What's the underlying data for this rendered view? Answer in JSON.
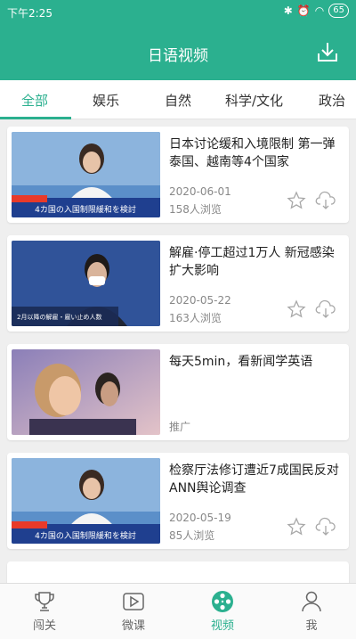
{
  "status_bar": {
    "time": "下午2:25",
    "battery": "65"
  },
  "header": {
    "title": "日语视频"
  },
  "tabs": [
    {
      "label": "全部",
      "active": true
    },
    {
      "label": "娱乐",
      "active": false
    },
    {
      "label": "自然",
      "active": false
    },
    {
      "label": "科学/文化",
      "active": false
    },
    {
      "label": "政治",
      "active": false
    }
  ],
  "videos": [
    {
      "title": "日本讨论缓和入境限制 第一弹泰国、越南等4个国家",
      "date": "2020-06-01",
      "views": "158人浏览",
      "thumb_caption": "4カ国の入国制限緩和を検討"
    },
    {
      "title": "解雇·停工超过1万人 新冠感染扩大影响",
      "date": "2020-05-22",
      "views": "163人浏览",
      "thumb_caption": "2月以降の解雇・雇い止め人数"
    },
    {
      "title": "每天5min，看新闻学英语",
      "ad_label": "推广"
    },
    {
      "title": "检察厅法修订遭近7成国民反对 ANN舆论调查",
      "date": "2020-05-19",
      "views": "85人浏览",
      "thumb_caption": "4カ国の入国制限緩和を検討"
    }
  ],
  "bottom_nav": [
    {
      "label": "闯关",
      "icon": "trophy-icon",
      "active": false
    },
    {
      "label": "微课",
      "icon": "play-icon",
      "active": false
    },
    {
      "label": "视频",
      "icon": "film-reel-icon",
      "active": true
    },
    {
      "label": "我",
      "icon": "person-icon",
      "active": false
    }
  ],
  "colors": {
    "accent": "#2bb08f",
    "background": "#efefef"
  }
}
